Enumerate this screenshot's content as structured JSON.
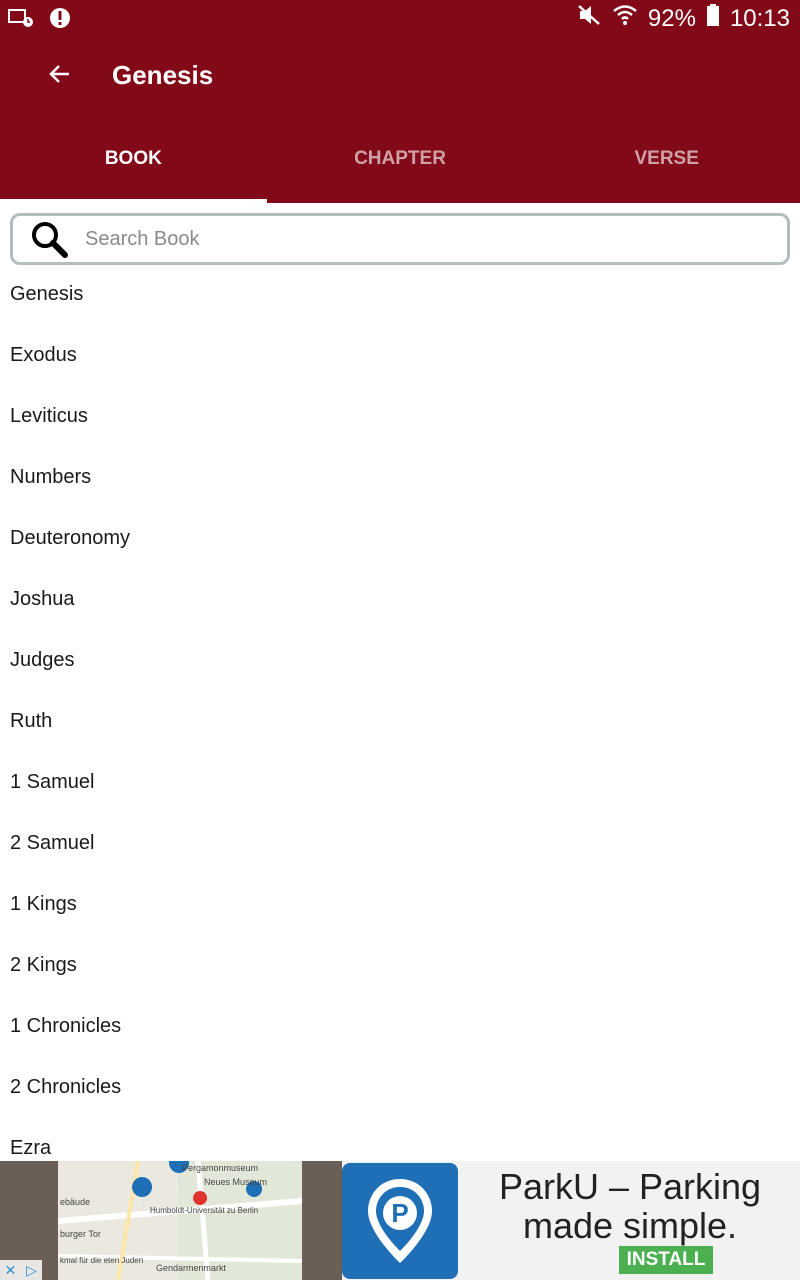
{
  "status_bar": {
    "battery": "92%",
    "time": "10:13"
  },
  "toolbar": {
    "title": "Genesis"
  },
  "tabs": [
    {
      "label": "BOOK",
      "active": true
    },
    {
      "label": "CHAPTER",
      "active": false
    },
    {
      "label": "VERSE",
      "active": false
    }
  ],
  "search": {
    "placeholder": "Search Book",
    "value": ""
  },
  "books": [
    "Genesis",
    "Exodus",
    "Leviticus",
    "Numbers",
    "Deuteronomy",
    "Joshua",
    "Judges",
    "Ruth",
    "1 Samuel",
    "2 Samuel",
    "1 Kings",
    "2 Kings",
    "1 Chronicles",
    "2 Chronicles",
    "Ezra"
  ],
  "ad": {
    "headline": "ParkU – Parking made simple.",
    "install_label": "INSTALL",
    "logo_letter": "P",
    "map_labels": [
      "Pergamonmuseum",
      "Neues Museum",
      "ebäude",
      "Humboldt-Universität zu Berlin",
      "burger Tor",
      "Gendarmenmarkt",
      "kmal für die eten Juden"
    ]
  },
  "colors": {
    "appbar": "#820917",
    "install": "#4caf50",
    "ad_logo": "#1e6fb5"
  }
}
